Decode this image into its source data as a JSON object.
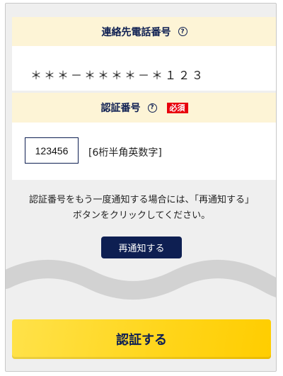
{
  "phone_section": {
    "title": "連絡先電話番号",
    "help_icon": "?",
    "masked_number": "＊＊＊－＊＊＊＊－＊１２３"
  },
  "code_section": {
    "title": "認証番号",
    "help_icon": "?",
    "required_badge": "必須",
    "input_value": "123456",
    "hint": "[6桁半角英数字]"
  },
  "notice": {
    "line1": "認証番号をもう一度通知する場合には、「再通知する」",
    "line2": "ボタンをクリックしてください。"
  },
  "buttons": {
    "renotify_label": "再通知する",
    "submit_label": "認証する"
  },
  "colors": {
    "header_bg": "#fdf4d6",
    "navy": "#0e1f52",
    "required_red": "#e8000c",
    "submit_yellow": "#ffd519"
  }
}
